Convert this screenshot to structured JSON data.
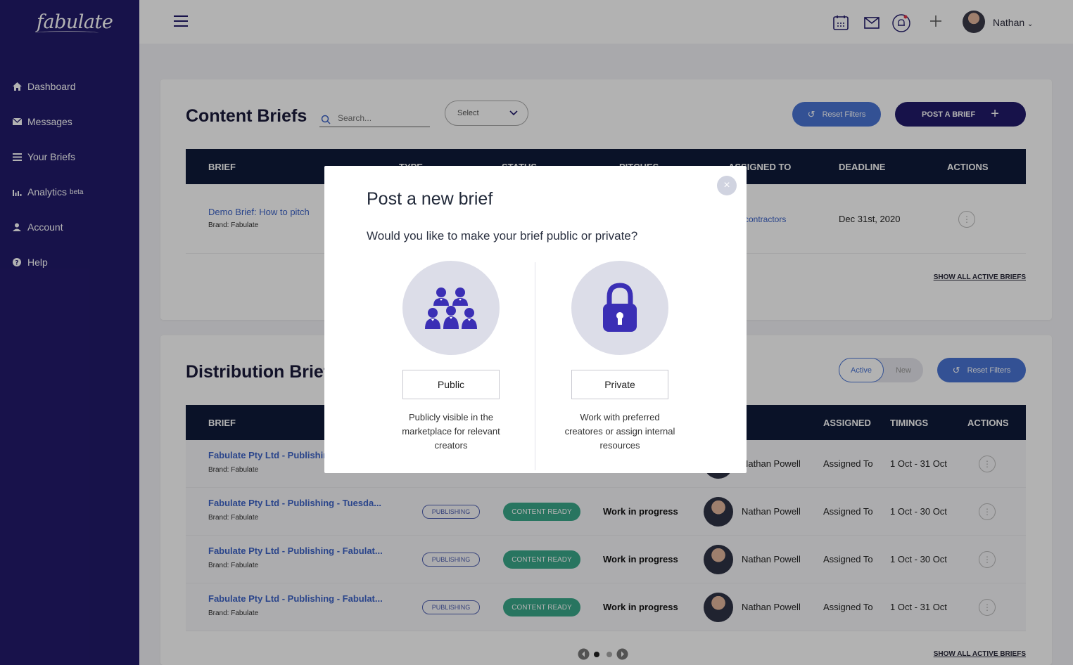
{
  "app": {
    "logo_text": "fabulate"
  },
  "sidebar": {
    "items": [
      {
        "label": "Dashboard",
        "icon": "home-icon"
      },
      {
        "label": "Messages",
        "icon": "envelope-icon"
      },
      {
        "label": "Your Briefs",
        "icon": "list-icon"
      },
      {
        "label": "Analytics",
        "icon": "bar-chart-icon",
        "sup": "beta"
      },
      {
        "label": "Account",
        "icon": "user-icon"
      },
      {
        "label": "Help",
        "icon": "help-icon"
      }
    ]
  },
  "topbar": {
    "user_name": "Nathan"
  },
  "content_briefs": {
    "title": "Content Briefs",
    "search_placeholder": "Search...",
    "select_label": "Select",
    "reset_label": "Reset Filters",
    "post_label": "POST A BRIEF",
    "columns": [
      "BRIEF",
      "TYPE",
      "STATUS",
      "PITCHES",
      "ASSIGNED TO",
      "DEADLINE",
      "ACTIONS"
    ],
    "row": {
      "title": "Demo Brief: How to pitch",
      "brand": "Brand: Fabulate",
      "assigned": "contractors",
      "deadline": "Dec 31st, 2020"
    },
    "show_all": "SHOW ALL ACTIVE BRIEFS"
  },
  "distribution_briefs": {
    "title": "Distribution Briefs",
    "toggle_active": "Active",
    "toggle_new": "New",
    "reset_label": "Reset Filters",
    "columns": [
      "BRIEF",
      "ASSIGNED",
      "TIMINGS",
      "ACTIONS"
    ],
    "rows": [
      {
        "title": "Fabulate Pty Ltd - Publishing",
        "brand": "Brand: Fabulate",
        "type": "",
        "status": "",
        "progress": "",
        "person": "Nathan Powell",
        "assigned": "Assigned To",
        "timing": "1 Oct - 31 Oct"
      },
      {
        "title": "Fabulate Pty Ltd - Publishing - Tuesda...",
        "brand": "Brand: Fabulate",
        "type": "PUBLISHING",
        "status": "CONTENT READY",
        "progress": "Work in progress",
        "person": "Nathan Powell",
        "assigned": "Assigned To",
        "timing": "1 Oct - 30 Oct"
      },
      {
        "title": "Fabulate Pty Ltd - Publishing - Fabulat...",
        "brand": "Brand: Fabulate",
        "type": "PUBLISHING",
        "status": "CONTENT READY",
        "progress": "Work in progress",
        "person": "Nathan Powell",
        "assigned": "Assigned To",
        "timing": "1 Oct - 30 Oct"
      },
      {
        "title": "Fabulate Pty Ltd - Publishing - Fabulat...",
        "brand": "Brand: Fabulate",
        "type": "PUBLISHING",
        "status": "CONTENT READY",
        "progress": "Work in progress",
        "person": "Nathan Powell",
        "assigned": "Assigned To",
        "timing": "1 Oct - 31 Oct"
      }
    ],
    "show_all": "SHOW ALL ACTIVE BRIEFS"
  },
  "modal": {
    "title": "Post a new brief",
    "question": "Would you like to make your brief public or private?",
    "public": {
      "label": "Public",
      "desc": "Publicly visible in the marketplace for relevant creators",
      "icon": "group-icon"
    },
    "private": {
      "label": "Private",
      "desc": "Work with preferred creatores or assign internal resources",
      "icon": "lock-icon"
    },
    "close_icon": "close-icon"
  },
  "colors": {
    "sidebar": "#221a6b",
    "accent": "#4a74d4",
    "header": "#0f1a3a",
    "ready": "#3aa88a"
  }
}
